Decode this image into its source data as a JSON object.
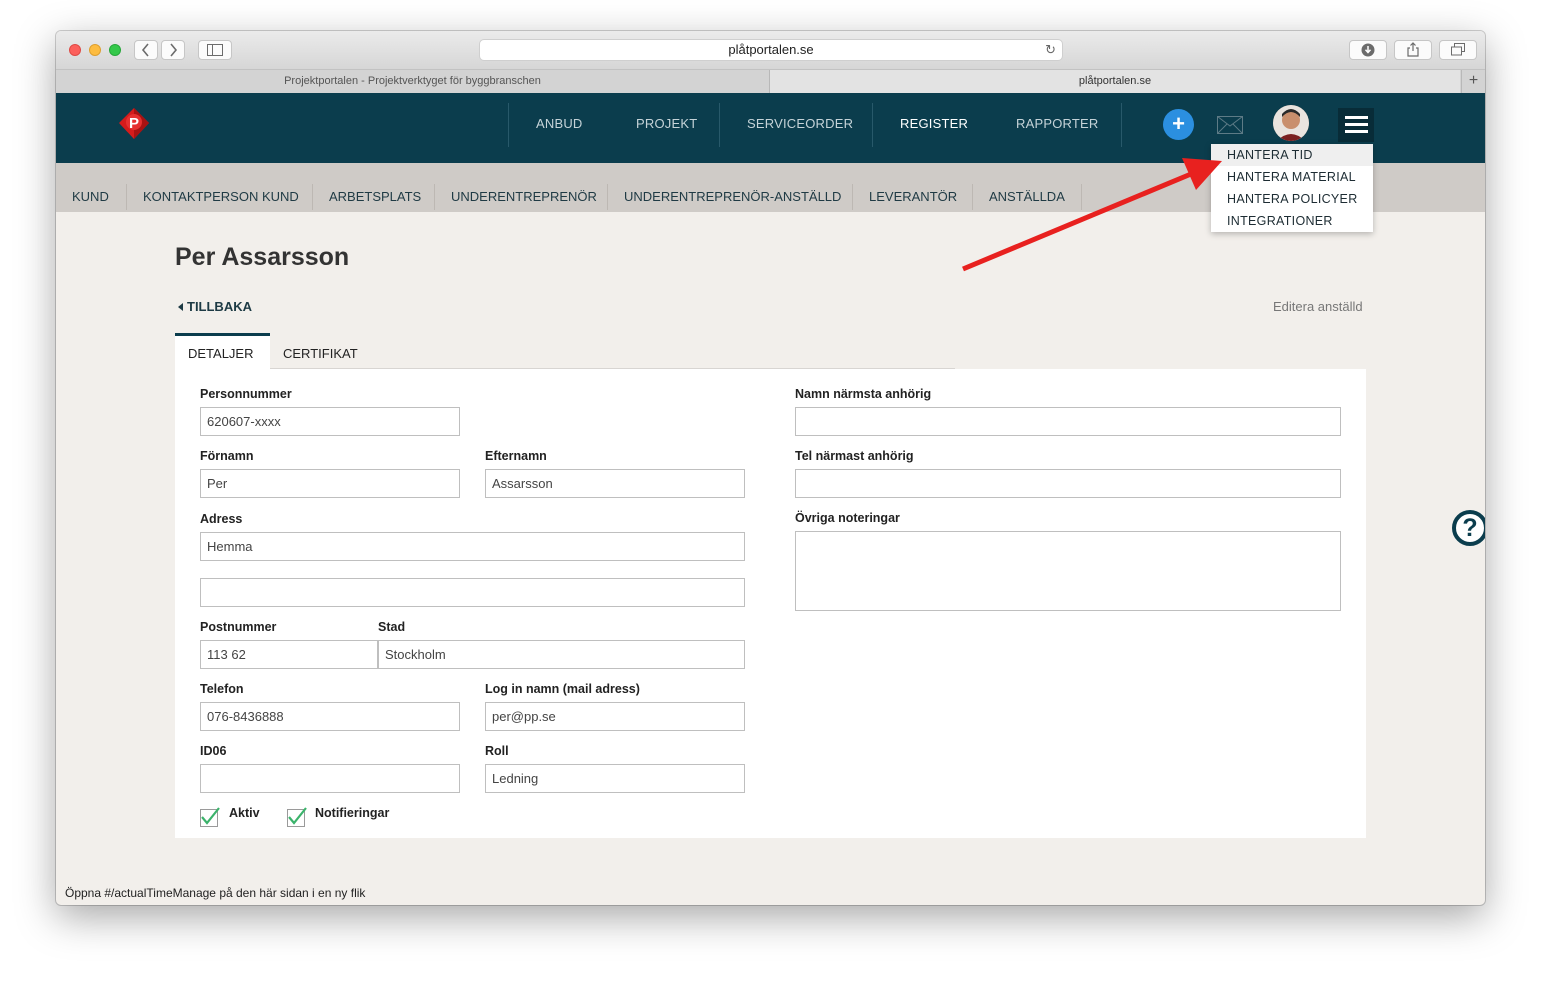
{
  "browser": {
    "url": "plåtportalen.se",
    "tabs": [
      "Projektportalen - Projektverktyget för byggbranschen",
      "plåtportalen.se"
    ],
    "status_text": "Öppna #/actualTimeManage på den här sidan i en ny flik"
  },
  "nav": {
    "items": [
      "ANBUD",
      "PROJEKT",
      "SERVICEORDER",
      "REGISTER",
      "RAPPORTER"
    ],
    "active": "REGISTER",
    "plus_label": "+"
  },
  "menu": {
    "items": [
      "HANTERA TID",
      "HANTERA MATERIAL",
      "HANTERA POLICYER",
      "INTEGRATIONER"
    ],
    "highlighted": "HANTERA TID"
  },
  "subnav": {
    "items": [
      "KUND",
      "KONTAKTPERSON KUND",
      "ARBETSPLATS",
      "UNDERENTREPRENÖR",
      "UNDERENTREPRENÖR-ANSTÄLLD",
      "LEVERANTÖR",
      "ANSTÄLLDA"
    ]
  },
  "page": {
    "title": "Per Assarsson",
    "back_label": "TILLBAKA",
    "edit_label": "Editera anställd",
    "tabs": [
      "DETALJER",
      "CERTIFIKAT"
    ]
  },
  "form": {
    "personnummer": {
      "label": "Personnummer",
      "value": "620607-xxxx"
    },
    "fornamn": {
      "label": "Förnamn",
      "value": "Per"
    },
    "efternamn": {
      "label": "Efternamn",
      "value": "Assarsson"
    },
    "adress": {
      "label": "Adress",
      "value": "Hemma",
      "value2": ""
    },
    "postnummer": {
      "label": "Postnummer",
      "value": "113 62"
    },
    "stad": {
      "label": "Stad",
      "value": "Stockholm"
    },
    "telefon": {
      "label": "Telefon",
      "value": "076-8436888"
    },
    "login": {
      "label": "Log in namn (mail adress)",
      "value": "per@pp.se"
    },
    "id06": {
      "label": "ID06",
      "value": ""
    },
    "roll": {
      "label": "Roll",
      "value": "Ledning"
    },
    "aktiv": {
      "label": "Aktiv",
      "checked": true
    },
    "notifieringar": {
      "label": "Notifieringar",
      "checked": true
    },
    "anhorig": {
      "label": "Namn närmsta anhörig",
      "value": ""
    },
    "tel_anhorig": {
      "label": "Tel närmast anhörig",
      "value": ""
    },
    "noteringar": {
      "label": "Övriga noteringar",
      "value": ""
    }
  },
  "help_label": "?",
  "colors": {
    "header": "#0b3d4d",
    "accent": "#2b8fe0",
    "annotation": "#e8211f",
    "check": "#3bb36b"
  }
}
